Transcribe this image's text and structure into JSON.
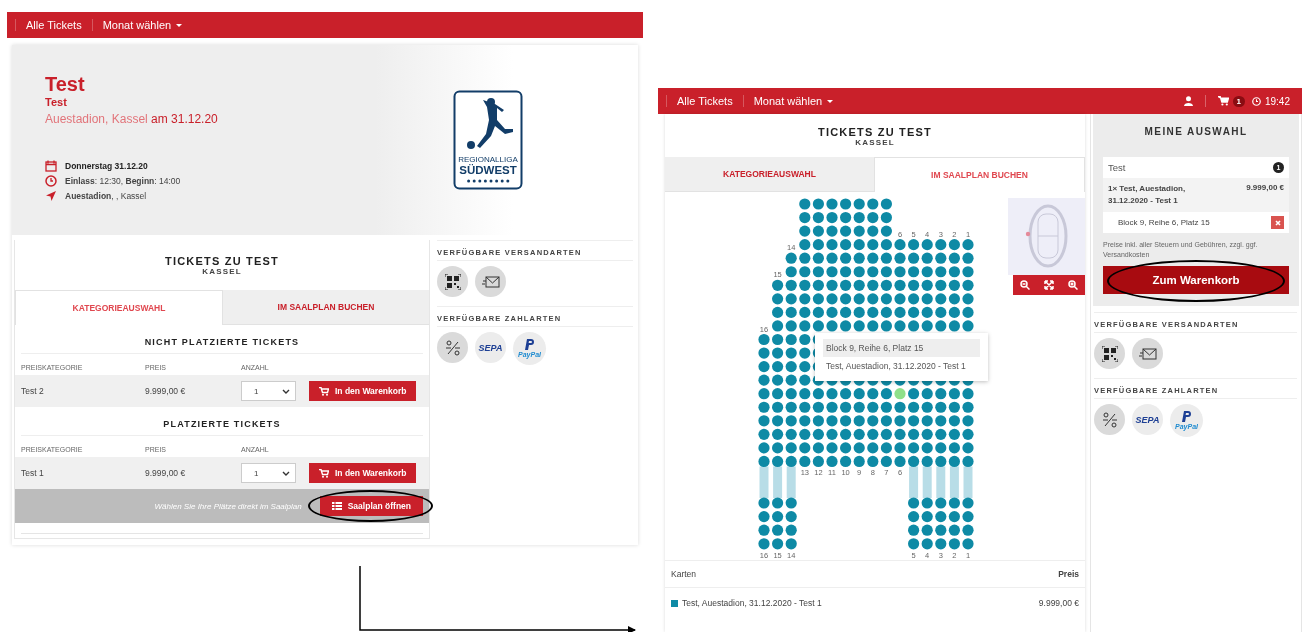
{
  "left_screen": {
    "nav": [
      {
        "label": "Alle Tickets",
        "dropdown": false
      },
      {
        "label": "Monat wählen",
        "dropdown": true
      }
    ],
    "event": {
      "title": "Test",
      "subtitle": "Test",
      "venue": "Auestadion, Kassel",
      "date_text": "am 31.12.20",
      "details": [
        {
          "kind": "date",
          "text": "Donnerstag 31.12.20"
        },
        {
          "kind": "time",
          "text": "**Einlass**: 12:30, **Beginn**: 14:00"
        },
        {
          "kind": "place",
          "text": "**Auestadion**, , Kassel"
        }
      ],
      "logo": {
        "line_1": "REGIONALLIGA",
        "line_2": "SÜDWEST"
      }
    },
    "tickets": {
      "title": "TICKETS ZU TEST",
      "subtitle": "KASSEL",
      "tabs": [
        {
          "label": "KATEGORIEAUSWAHL",
          "selected": true
        },
        {
          "label": "IM SAALPLAN BUCHEN",
          "selected": false
        }
      ],
      "sections": [
        {
          "heading": "NICHT PLATZIERTE TICKETS",
          "columns": [
            "PREISKATEGORIE",
            "PREIS",
            "ANZAHL"
          ],
          "rows": [
            {
              "category": "Test 2",
              "price": "9.999,00 €",
              "quantity": "1",
              "button": "In den Warenkorb"
            }
          ]
        },
        {
          "heading": "PLATZIERTE TICKETS",
          "columns": [
            "PREISKATEGORIE",
            "PREIS",
            "ANZAHL"
          ],
          "rows": [
            {
              "category": "Test 1",
              "price": "9.999,00 €",
              "quantity": "1",
              "button": "In den Warenkorb"
            }
          ],
          "seat_plan": {
            "hint": "Wählen Sie Ihre Plätze direkt im Saalplan",
            "button": "Saalplan öffnen",
            "circled": true
          }
        }
      ]
    },
    "shipping": {
      "heading": "VERFÜGBARE VERSANDARTEN",
      "methods": [
        {
          "kind": "qr"
        },
        {
          "kind": "mail"
        }
      ]
    },
    "payment": {
      "heading": "VERFÜGBARE ZAHLARTEN",
      "methods": [
        {
          "kind": "transfer"
        },
        {
          "kind": "sepa",
          "label": "SEPA"
        },
        {
          "kind": "paypal",
          "label": "PayPal"
        }
      ]
    }
  },
  "right_screen": {
    "nav": [
      {
        "label": "Alle Tickets",
        "dropdown": false
      },
      {
        "label": "Monat wählen",
        "dropdown": true
      }
    ],
    "cart_count": "1",
    "clock": "19:42",
    "title": "TICKETS ZU TEST",
    "subtitle": "KASSEL",
    "tabs": [
      {
        "label": "KATEGORIEAUSWAHL",
        "selected": false
      },
      {
        "label": "IM SAALPLAN BUCHEN",
        "selected": true
      }
    ],
    "seat_map": {
      "columns": [
        {
          "top_label": "16",
          "bottom_label": "16"
        },
        {
          "top_label": "15",
          "bottom_label": "15"
        },
        {
          "top_label": "14",
          "bottom_label": "14"
        },
        {
          "bottom_label": "13"
        },
        {
          "bottom_label": "12"
        },
        {
          "bottom_label": "11"
        },
        {
          "bottom_label": "10"
        },
        {
          "bottom_label": "9"
        },
        {
          "bottom_label": "8"
        },
        {
          "bottom_label": "7"
        },
        {
          "top_label": "6",
          "bottom_label": "6"
        },
        {
          "top_label": "5",
          "bottom_label": "5"
        },
        {
          "top_label": "4",
          "bottom_label": "4"
        },
        {
          "top_label": "3",
          "bottom_label": "3"
        },
        {
          "top_label": "2",
          "bottom_label": "2"
        },
        {
          "top_label": "1",
          "bottom_label": "1"
        }
      ],
      "hover": {
        "active": true,
        "lines": [
          "Block 9, Reihe 6, Platz 15",
          "Test, Auestadion, 31.12.2020 - Test 1"
        ]
      }
    },
    "cards_table": {
      "columns": [
        "Karten",
        "Preis"
      ],
      "rows": [
        {
          "name": "Test, Auestadion, 31.12.2020 - Test 1",
          "price": "9.999,00 €",
          "color": "#0e8aa5"
        }
      ]
    },
    "selection": {
      "heading": "MEINE AUSWAHL",
      "event": "Test",
      "count": "1",
      "item": "1× Test, Auestadion, 31.12.2020 - Test 1",
      "item_price": "9.999,00 €",
      "seat": "Block 9, Reihe 6, Platz 15",
      "note": "Preise inkl. aller Steuern und Gebühren, zzgl. ggf. Versandkosten",
      "button": "Zum Warenkorb",
      "circled": true
    },
    "shipping": {
      "heading": "VERFÜGBARE VERSANDARTEN",
      "methods": [
        {
          "kind": "qr"
        },
        {
          "kind": "mail"
        }
      ]
    },
    "payment": {
      "heading": "VERFÜGBARE ZAHLARTEN",
      "methods": [
        {
          "kind": "transfer"
        },
        {
          "kind": "sepa",
          "label": "SEPA"
        },
        {
          "kind": "paypal",
          "label": "PayPal"
        }
      ]
    }
  }
}
